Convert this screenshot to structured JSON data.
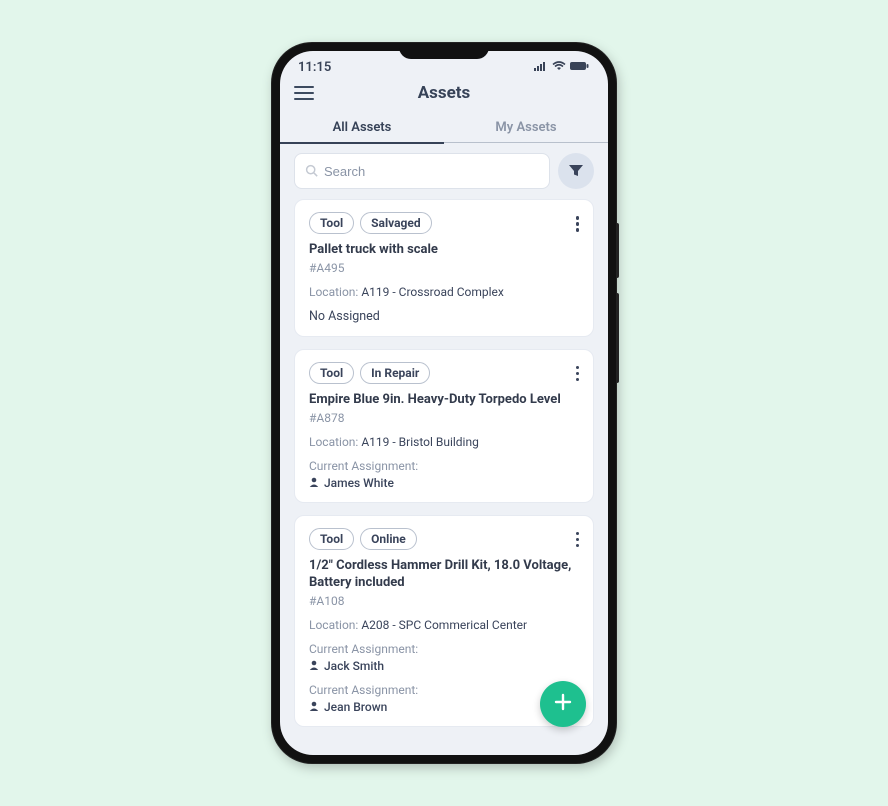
{
  "status": {
    "time": "11:15"
  },
  "header": {
    "title": "Assets"
  },
  "tabs": {
    "all": {
      "label": "All Assets"
    },
    "my": {
      "label": "My Assets"
    }
  },
  "search": {
    "placeholder": "Search"
  },
  "labels": {
    "location": "Location:",
    "current_assignment": "Current Assignment:",
    "no_assigned": "No Assigned"
  },
  "assets": [
    {
      "chip1": "Tool",
      "chip2": "Salvaged",
      "title": "Pallet truck with scale",
      "id": "#A495",
      "location": "A119 - Crossroad Complex",
      "no_assigned": true,
      "assignments": []
    },
    {
      "chip1": "Tool",
      "chip2": "In Repair",
      "title": "Empire Blue 9in. Heavy-Duty Torpedo Level",
      "id": "#A878",
      "location": "A119 - Bristol Building",
      "no_assigned": false,
      "assignments": [
        {
          "name": "James White"
        }
      ]
    },
    {
      "chip1": "Tool",
      "chip2": "Online",
      "title": "1/2\" Cordless Hammer Drill Kit, 18.0 Voltage, Battery included",
      "id": "#A108",
      "location": "A208 - SPC Commerical Center",
      "no_assigned": false,
      "assignments": [
        {
          "name": "Jack Smith"
        },
        {
          "name": "Jean Brown"
        }
      ]
    }
  ]
}
